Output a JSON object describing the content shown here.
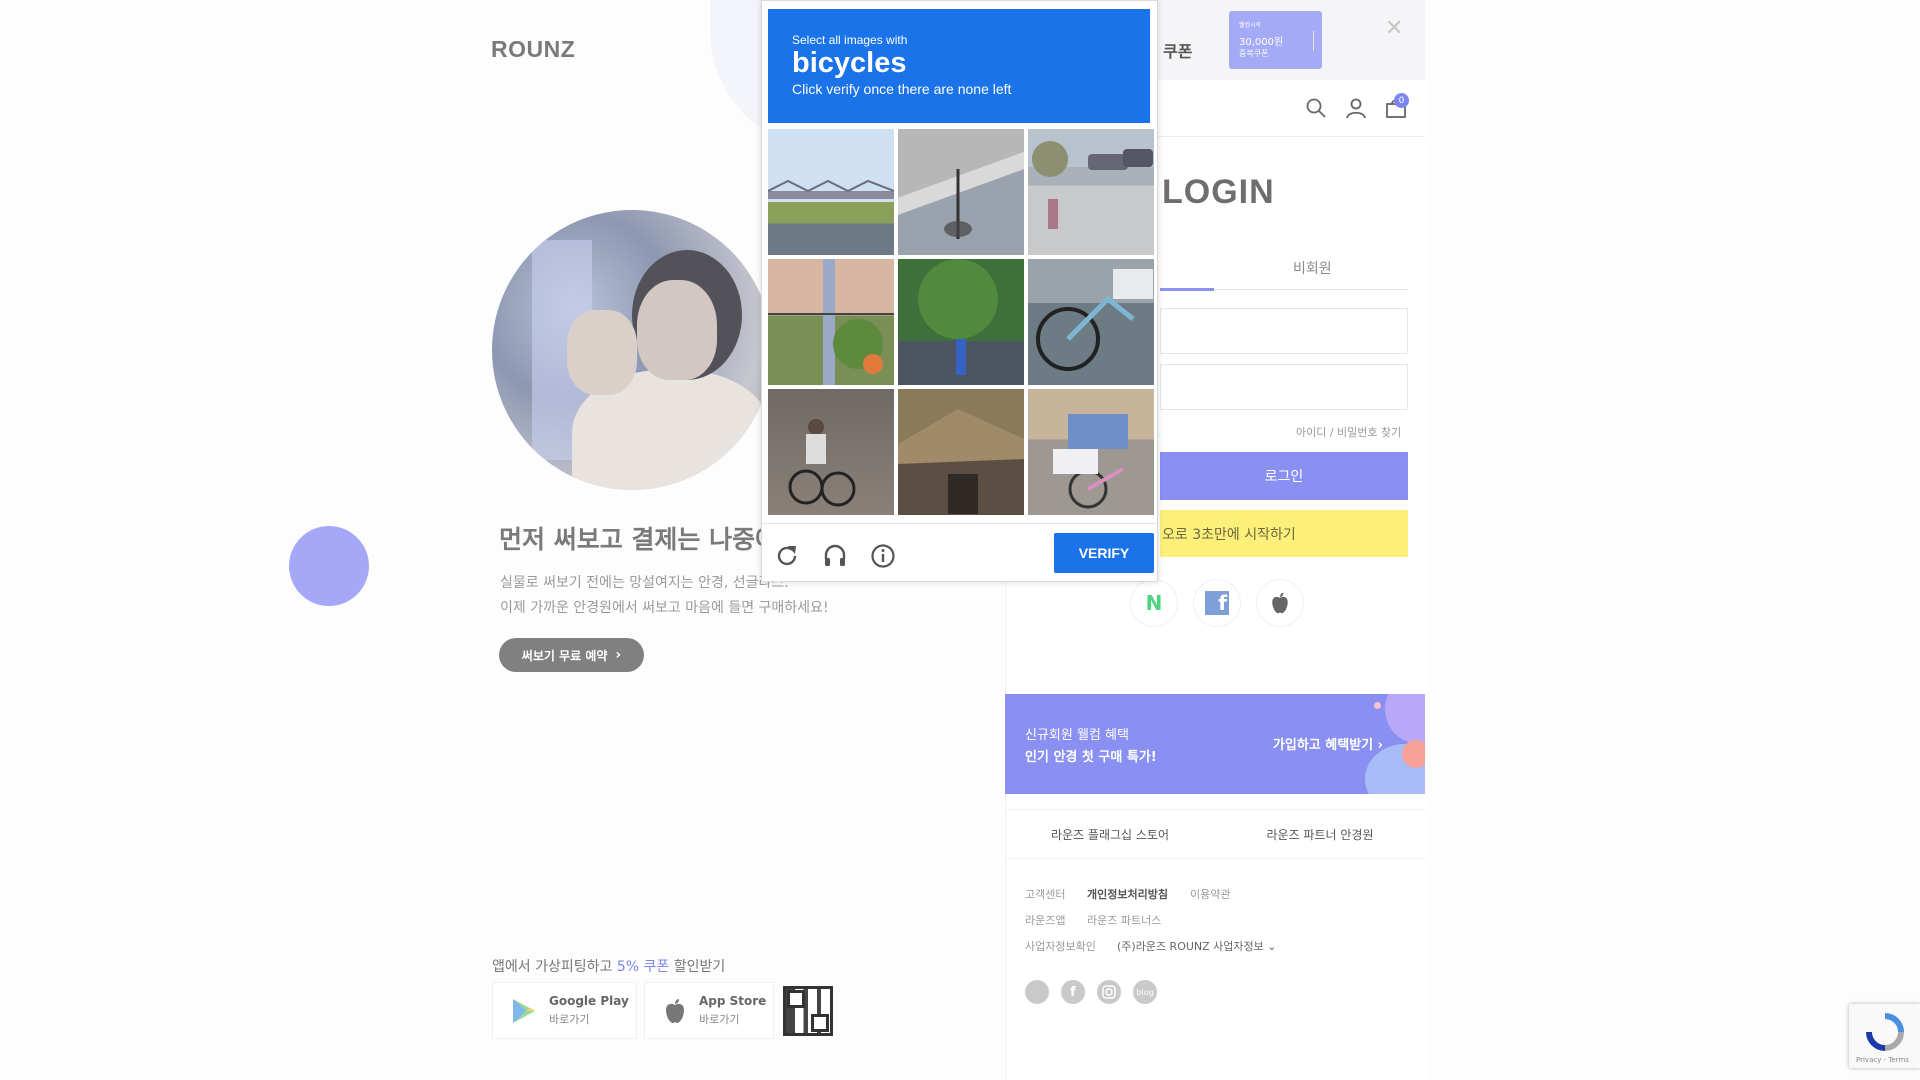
{
  "brand": {
    "logo": "ROUNZ"
  },
  "hero": {
    "title": "먼저 써보고 결제는 나중에",
    "desc_line1": "실물로 써보기 전에는 망설여지는 안경, 선글라스.",
    "desc_line2": "이제 가까운 안경원에서 써보고 마음에 들면 구매하세요!",
    "cta_label": "써보기 무료 예약",
    "cta_chevron": "›"
  },
  "app_promo": {
    "title_prefix": "앱에서 가상피팅하고 ",
    "title_highlight": "5% 쿠폰",
    "title_suffix": " 할인받기",
    "google_name": "Google Play",
    "google_sub": "바로가기",
    "apple_name": "App Store",
    "apple_sub": "바로가기"
  },
  "topbar": {
    "coupon_tab": "쿠폰",
    "ticket_small": "웰컴시작",
    "ticket_amount": "30,000원",
    "ticket_desc": "중복쿠폰",
    "close": "✕"
  },
  "header": {
    "cart_count": "0"
  },
  "login": {
    "title": "LOGIN",
    "tab_guest": "비회원",
    "find_link": "아이디 / 비밀번호 찾기",
    "login_button": "로그인",
    "kakao_button": "오로 3초만에 시작하기",
    "social_naver": "N",
    "social_facebook": "f",
    "social_apple": ""
  },
  "banner": {
    "line1": "신규회원 웰컴 혜택",
    "line2": "인기 안경 첫 구매 특가!",
    "cta": "가입하고 혜택받기 ›"
  },
  "store_links": {
    "flagship": "라운즈 플래그십 스토어",
    "partner": "라운즈 파트너 안경원"
  },
  "footer": {
    "customer_center": "고객센터",
    "privacy": "개인정보처리방침",
    "terms": "이용약관",
    "app": "라운즈앱",
    "partners": "라운즈 파트너스",
    "business_check": "사업자정보확인",
    "business_info": "(주)라운즈 ROUNZ 사업자정보 ⌄",
    "sns_blog": "blog"
  },
  "captcha": {
    "instruction_line1": "Select all images with",
    "target": "bicycles",
    "instruction_line3": "Click verify once there are none left",
    "verify_label": "VERIFY"
  },
  "recaptcha_badge": {
    "text": "Privacy - Terms"
  },
  "colors": {
    "accent": "#8a90f2",
    "captcha_blue": "#1a73e8",
    "kakao_yellow": "#fdf07a"
  }
}
